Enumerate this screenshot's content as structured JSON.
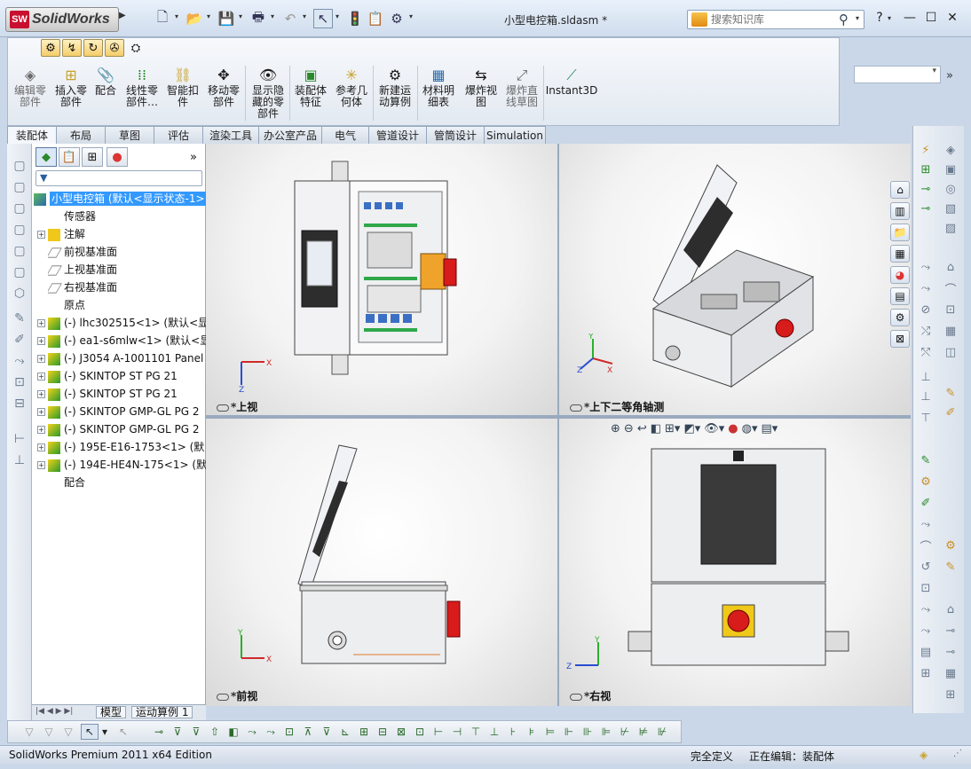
{
  "app": {
    "name": "SolidWorks",
    "logo_text": "SW",
    "document_title": "小型电控箱.sldasm *"
  },
  "search": {
    "placeholder": "搜索知识库"
  },
  "window": {
    "help": "?",
    "minimize": "—",
    "maximize": "☐",
    "close": "✕"
  },
  "commands": [
    {
      "label": "编辑零\n部件",
      "icon": "edit-component-icon",
      "disabled": true
    },
    {
      "label": "插入零\n部件",
      "icon": "insert-component-icon"
    },
    {
      "label": "配合",
      "icon": "mate-icon"
    },
    {
      "label": "线性零\n部件…",
      "icon": "linear-pattern-icon"
    },
    {
      "label": "智能扣\n件",
      "icon": "smart-fastener-icon"
    },
    {
      "label": "移动零\n部件",
      "icon": "move-component-icon"
    },
    {
      "label": "显示隐\n藏的零\n部件",
      "icon": "show-hidden-icon"
    },
    {
      "label": "装配体\n特征",
      "icon": "assembly-feature-icon"
    },
    {
      "label": "参考几\n何体",
      "icon": "reference-geometry-icon"
    },
    {
      "label": "新建运\n动算例",
      "icon": "new-motion-study-icon"
    },
    {
      "label": "材料明\n细表",
      "icon": "bom-icon"
    },
    {
      "label": "爆炸视\n图",
      "icon": "exploded-view-icon"
    },
    {
      "label": "爆炸直\n线草图",
      "icon": "explode-line-sketch-icon",
      "disabled": true
    },
    {
      "label": "Instant3D",
      "icon": "instant3d-icon"
    }
  ],
  "tabs": [
    "装配体",
    "布局",
    "草图",
    "评估",
    "渲染工具",
    "办公室产品",
    "电气",
    "管道设计",
    "管筒设计",
    "Simulation"
  ],
  "feature_tree": {
    "root": "小型电控箱  (默认<显示状态-1>",
    "items": [
      {
        "label": "传感器",
        "expand": false
      },
      {
        "label": "注解",
        "expand": true
      },
      {
        "label": "前视基准面",
        "expand": false
      },
      {
        "label": "上视基准面",
        "expand": false
      },
      {
        "label": "右视基准面",
        "expand": false
      },
      {
        "label": "原点",
        "expand": false
      },
      {
        "label": "(-) lhc302515<1> (默认<显",
        "expand": true
      },
      {
        "label": "(-) ea1-s6mlw<1> (默认<显",
        "expand": true
      },
      {
        "label": "(-) J3054 A-1001101 Panel",
        "expand": true
      },
      {
        "label": "(-) SKINTOP ST PG 21",
        "expand": true
      },
      {
        "label": "(-) SKINTOP ST PG 21",
        "expand": true
      },
      {
        "label": "(-) SKINTOP GMP-GL PG 2",
        "expand": true
      },
      {
        "label": "(-) SKINTOP GMP-GL PG 2",
        "expand": true
      },
      {
        "label": "(-) 195E-E16-1753<1> (默",
        "expand": true
      },
      {
        "label": "(-) 194E-HE4N-175<1> (默",
        "expand": true
      },
      {
        "label": "配合",
        "expand": false
      }
    ],
    "bottom_tabs": [
      "模型",
      "运动算例 1"
    ]
  },
  "viewports": {
    "top_left": "*上视",
    "top_right": "*上下二等角轴测",
    "bottom_left": "*前视",
    "bottom_right": "*右视"
  },
  "triad": {
    "x": "X",
    "y": "Y",
    "z": "Z"
  },
  "status": {
    "edition": "SolidWorks Premium 2011 x64 Edition",
    "state": "完全定义",
    "editing": "正在编辑：装配体"
  }
}
